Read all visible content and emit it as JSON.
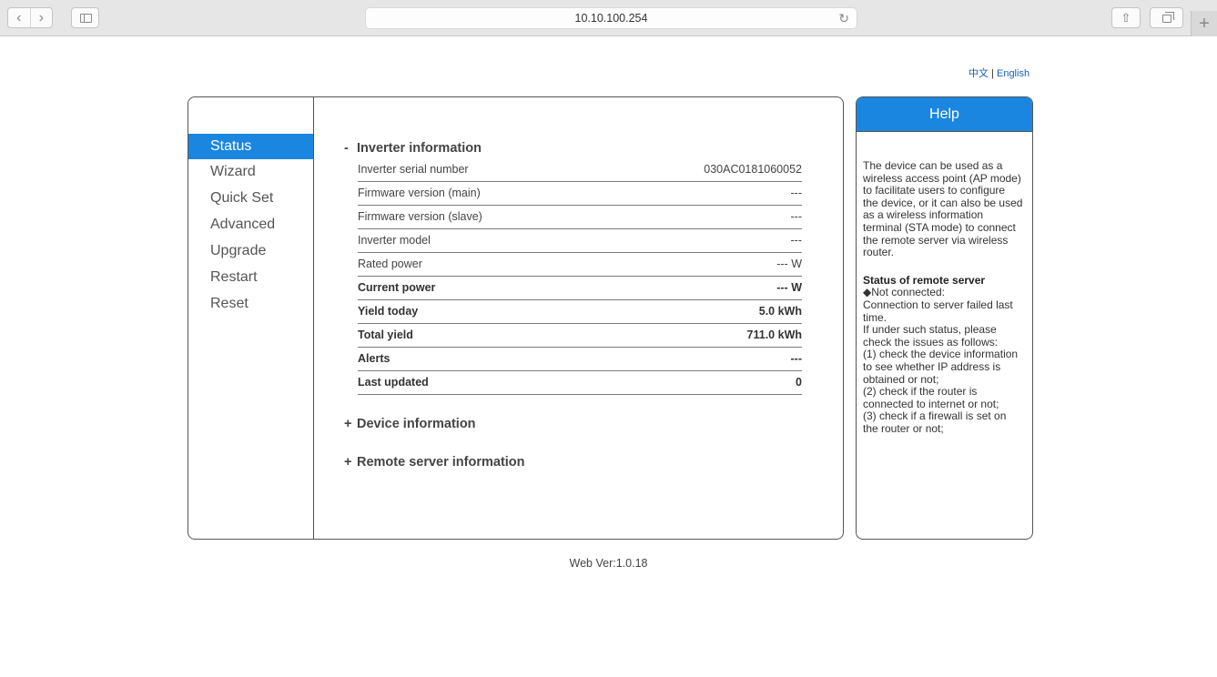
{
  "browser": {
    "url": "10.10.100.254",
    "back_glyph": "‹",
    "forward_glyph": "›",
    "reload_glyph": "↻",
    "share_glyph": "⇧",
    "newtab_glyph": "+"
  },
  "lang": {
    "chinese": "中文",
    "separator": "|",
    "english": "English"
  },
  "menu": {
    "items": [
      {
        "label": "Status"
      },
      {
        "label": "Wizard"
      },
      {
        "label": "Quick Set"
      },
      {
        "label": "Advanced"
      },
      {
        "label": "Upgrade"
      },
      {
        "label": "Restart"
      },
      {
        "label": "Reset"
      }
    ],
    "active": "Status"
  },
  "sections": {
    "inverter": {
      "sign": "-",
      "title": "Inverter information"
    },
    "device": {
      "sign": "+",
      "title": "Device information"
    },
    "remote": {
      "sign": "+",
      "title": "Remote server information"
    }
  },
  "inverter_rows": [
    {
      "label": "Inverter serial number",
      "value": "030AC0181060052"
    },
    {
      "label": "Firmware version (main)",
      "value": "---"
    },
    {
      "label": "Firmware version (slave)",
      "value": "---"
    },
    {
      "label": "Inverter model",
      "value": "---"
    },
    {
      "label": "Rated power",
      "value": "--- W"
    },
    {
      "label": "Current power",
      "value": "--- W"
    },
    {
      "label": "Yield today",
      "value": "5.0 kWh"
    },
    {
      "label": "Total yield",
      "value": "711.0 kWh"
    },
    {
      "label": "Alerts",
      "value": "---"
    },
    {
      "label": "Last updated",
      "value": "0"
    }
  ],
  "help": {
    "title": "Help",
    "intro": "The device can be used as a wireless access point (AP mode) to facilitate users to configure the device, or it can also be used as a wireless information terminal (STA mode) to connect the remote server via wireless router.",
    "remote_heading": "Status of remote server",
    "lines": [
      "◆Not connected:",
      "Connection to server failed last time.",
      "If under such status, please check the issues as follows:",
      "(1) check the device information to see whether IP address is obtained or not;",
      "(2) check if the router is connected to internet or not;",
      "(3) check if a firewall is set on the router or not;"
    ]
  },
  "footer": {
    "web_version": "Web Ver:1.0.18"
  },
  "colors": {
    "accent": "#1a86e0",
    "link": "#1a5fb4"
  }
}
